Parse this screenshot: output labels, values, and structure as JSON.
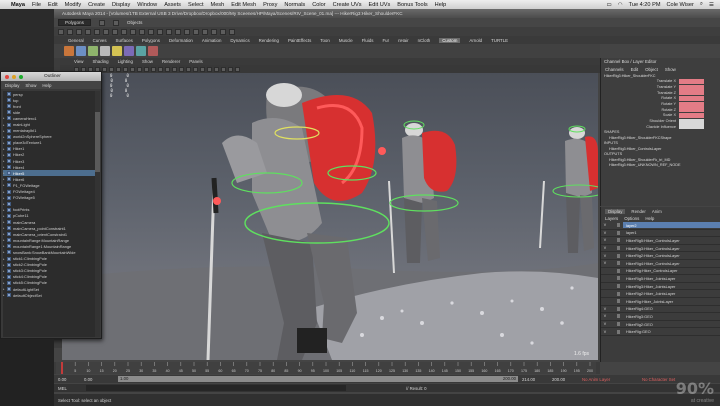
{
  "mac_menubar": {
    "app_name": "Maya",
    "items": [
      "File",
      "Edit",
      "Modify",
      "Create",
      "Display",
      "Window",
      "Assets",
      "Select",
      "Mesh",
      "Edit Mesh",
      "Proxy",
      "Normals",
      "Color",
      "Create UVs",
      "Edit UVs",
      "Bonus Tools",
      "Help"
    ],
    "clock": "Tue 4:20 PM",
    "user": "Cole Wiser"
  },
  "maya": {
    "window_title": "Autodesk Maya 2014 - [Volumes/1TB External USB 3 Drive/Dropbox/Dropbox/000/My Sceenes/HP/Maya/Scenes/RIV_Scene_01.ma] --- HikerRig3:Hiker_ShoulderFKC",
    "menu_mode": "Polygons",
    "menu_objects": "Objects",
    "shelf_tabs": [
      "General",
      "Curves",
      "Surfaces",
      "Polygons",
      "Deformation",
      "Animation",
      "Dynamics",
      "Rendering",
      "PaintEffects",
      "Toon",
      "Muscle",
      "Fluids",
      "Fur",
      "nHair",
      "nCloth",
      "Custom",
      "Arnold",
      "TURTLE"
    ],
    "active_shelf_tab": "Custom",
    "viewport_menu": [
      "View",
      "Shading",
      "Lighting",
      "Show",
      "Renderer",
      "Panels"
    ],
    "hud_lines": [
      {
        "a": "94731",
        "b": "0",
        "c": "0"
      },
      {
        "a": "183939",
        "b": "0",
        "c": "0"
      },
      {
        "a": "96104",
        "b": "0",
        "c": "0"
      },
      {
        "a": "180704",
        "b": "0",
        "c": "0"
      },
      {
        "a": "94442",
        "b": "0",
        "c": "0"
      }
    ],
    "fps": "1.6 fps"
  },
  "outliner": {
    "title": "Outliner",
    "menu": [
      "Display",
      "Show",
      "Help"
    ],
    "items": [
      {
        "label": "persp",
        "selected": false
      },
      {
        "label": "top",
        "selected": false
      },
      {
        "label": "front",
        "selected": false
      },
      {
        "label": "side",
        "selected": false
      },
      {
        "label": "cameraHero1",
        "selected": false
      },
      {
        "label": "mainLight",
        "selected": false
      },
      {
        "label": "mentalrayIbl1",
        "selected": false
      },
      {
        "label": "world2nSphereSphere",
        "selected": false
      },
      {
        "label": "place3dTexture1",
        "selected": false
      },
      {
        "label": "Hiker1",
        "selected": false
      },
      {
        "label": "Hiker2",
        "selected": false
      },
      {
        "label": "Hiker3",
        "selected": false
      },
      {
        "label": "Hiker4",
        "selected": false
      },
      {
        "label": "Hiker5",
        "selected": true
      },
      {
        "label": "Hiker6",
        "selected": false
      },
      {
        "label": "P1_FGWeitage",
        "selected": false
      },
      {
        "label": "FGWeitage4",
        "selected": false
      },
      {
        "label": "FGWeitage5",
        "selected": false
      },
      {
        "label": "",
        "selected": false
      },
      {
        "label": "footPrints",
        "selected": false
      },
      {
        "label": "pCube11",
        "selected": false
      },
      {
        "label": "mainCamera",
        "selected": false
      },
      {
        "label": "mainCamera_pointConstraint1",
        "selected": false
      },
      {
        "label": "mainCamera_orientConstraint1",
        "selected": false
      },
      {
        "label": "mountainRange:MountainRange",
        "selected": false
      },
      {
        "label": "mountainRange1:MountainRange",
        "selected": false
      },
      {
        "label": "snowBank:SnowBankMountainWide",
        "selected": false
      },
      {
        "label": "stick1:ClimbingPole",
        "selected": false
      },
      {
        "label": "stick2:ClimbingPole",
        "selected": false
      },
      {
        "label": "stick3:ClimbingPole",
        "selected": false
      },
      {
        "label": "stick4:ClimbingPole",
        "selected": false
      },
      {
        "label": "stick5:ClimbingPole",
        "selected": false
      },
      {
        "label": "defaultLightSet",
        "selected": false
      },
      {
        "label": "defaultObjectSet",
        "selected": false
      }
    ]
  },
  "channel_box": {
    "header": "Channel Box / Layer Editor",
    "menu": [
      "Channels",
      "Edit",
      "Object",
      "Show"
    ],
    "object_name": "HikerRig3:Hiker_ShoulderFKC",
    "attributes": [
      {
        "name": "Translate X",
        "value": "",
        "color": "pink"
      },
      {
        "name": "Translate Y",
        "value": "",
        "color": "pink"
      },
      {
        "name": "Translate Z",
        "value": "",
        "color": "pink"
      },
      {
        "name": "Rotate X",
        "value": "",
        "color": "pink"
      },
      {
        "name": "Rotate Y",
        "value": "",
        "color": "pink"
      },
      {
        "name": "Rotate Z",
        "value": "",
        "color": "pink"
      },
      {
        "name": "Scale X",
        "value": "",
        "color": "pink"
      },
      {
        "name": "Shoulder Orient",
        "value": "",
        "color": "white"
      },
      {
        "name": "Clavicle Influence",
        "value": "",
        "color": "white"
      }
    ],
    "shapes_label": "SHAPES",
    "shape_name": "HikerRig3:Hiker_ShoulderFKCShape",
    "inputs_label": "INPUTS",
    "input_name": "HikerRig3:Hiker_ControlsLayer",
    "outputs_label": "OUTPUTS",
    "output_items": [
      "HikerRig3:Hiker_ShoulderFk_tri_MD",
      "HikerRig3:Hiker_UNKNOWN_REF_NODE"
    ]
  },
  "layer_editor": {
    "tabs": [
      "Display",
      "Render",
      "Anim"
    ],
    "active_tab": "Display",
    "menu": [
      "Layers",
      "Options",
      "Help"
    ],
    "layers": [
      {
        "vis": "V",
        "flag": "",
        "name": "layer2",
        "selected": true
      },
      {
        "vis": "V",
        "flag": "",
        "name": "layer1",
        "selected": false
      },
      {
        "vis": "V",
        "flag": "",
        "name": "HikerRig5:Hiker_ControlsLayer",
        "selected": false
      },
      {
        "vis": "V",
        "flag": "",
        "name": "HikerRig3:Hiker_ControlsLayer",
        "selected": false
      },
      {
        "vis": "V",
        "flag": "",
        "name": "HikerRig2:Hiker_ControlsLayer",
        "selected": false
      },
      {
        "vis": "V",
        "flag": "",
        "name": "HikerRig4:Hiker_ControlsLayer",
        "selected": false
      },
      {
        "vis": "",
        "flag": "",
        "name": "HikerRig:Hiker_ControlsLayer",
        "selected": false
      },
      {
        "vis": "",
        "flag": "",
        "name": "HikerRig5:Hiker_JointsLayer",
        "selected": false
      },
      {
        "vis": "",
        "flag": "",
        "name": "HikerRig3:Hiker_JointsLayer",
        "selected": false
      },
      {
        "vis": "",
        "flag": "",
        "name": "HikerRig2:Hiker_JointsLayer",
        "selected": false
      },
      {
        "vis": "",
        "flag": "",
        "name": "HikerRig:Hiker_JointsLayer",
        "selected": false
      },
      {
        "vis": "V",
        "flag": "",
        "name": "HikerRig4:GEO",
        "selected": false
      },
      {
        "vis": "V",
        "flag": "",
        "name": "HikerRig3:GEO",
        "selected": false
      },
      {
        "vis": "V",
        "flag": "",
        "name": "HikerRig2:GEO",
        "selected": false
      },
      {
        "vis": "V",
        "flag": "",
        "name": "HikerRig:GEO",
        "selected": false
      }
    ]
  },
  "time": {
    "ticks": [
      "1",
      "5",
      "10",
      "15",
      "20",
      "25",
      "30",
      "35",
      "40",
      "45",
      "50",
      "55",
      "60",
      "65",
      "70",
      "75",
      "80",
      "85",
      "90",
      "95",
      "100",
      "105",
      "110",
      "115",
      "120",
      "125",
      "130",
      "135",
      "140",
      "145",
      "150",
      "155",
      "160",
      "165",
      "170",
      "175",
      "180",
      "185",
      "190",
      "195",
      "200"
    ],
    "range_start": "0.00",
    "range_inner_start": "0.00",
    "current_frame_label": "1.00",
    "range_end_1": "200.00",
    "range_end_2": "214.00",
    "range_end_3": "200.00",
    "anim_layer": "No Anim Layer",
    "char_set": "No Character Set"
  },
  "command_line": {
    "lang": "MEL",
    "result": "// Result: 0"
  },
  "help_line": "Select Tool: select an object",
  "watermark": {
    "brand": "90%",
    "sub": "at creative"
  }
}
